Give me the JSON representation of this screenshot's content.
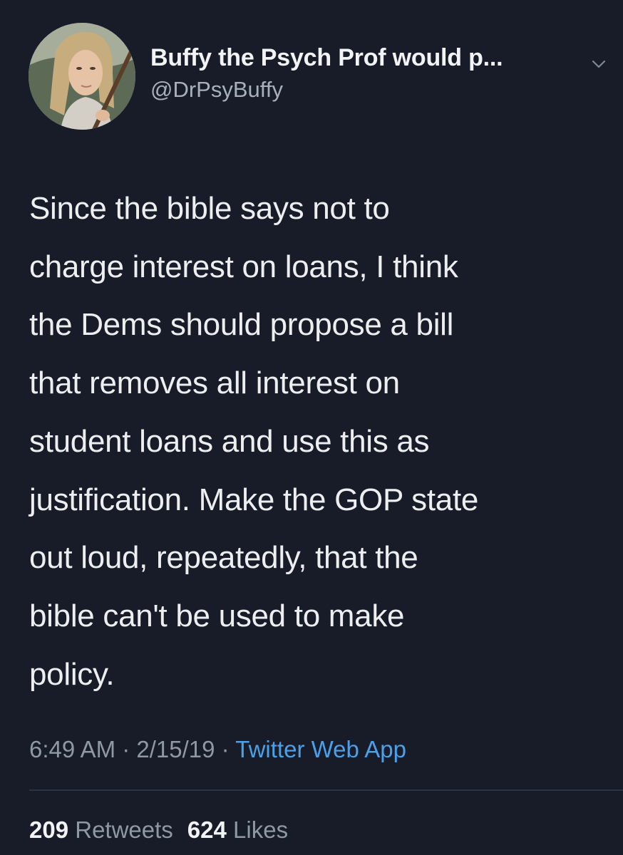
{
  "user": {
    "display_name": "Buffy the Psych Prof would p...",
    "handle": "@DrPsyBuffy"
  },
  "tweet": {
    "lines": [
      "Since the bible says not to",
      "charge interest on loans, I think",
      "the Dems should propose a bill",
      "that removes all interest on",
      "student loans and use this as",
      "justification. Make the GOP state",
      "out loud, repeatedly, that the",
      "bible can't be used to make",
      "policy."
    ],
    "time": "6:49 AM",
    "separator": " · ",
    "date": "2/15/19",
    "source": "Twitter Web App"
  },
  "stats": {
    "retweets_count": "209",
    "retweets_label": "Retweets",
    "likes_count": "624",
    "likes_label": "Likes"
  },
  "colors": {
    "background": "#171c28",
    "text": "#edeef0",
    "muted": "#8f98a3",
    "link": "#4ba0ea"
  },
  "icons": {
    "menu": "chevron-down-icon"
  }
}
